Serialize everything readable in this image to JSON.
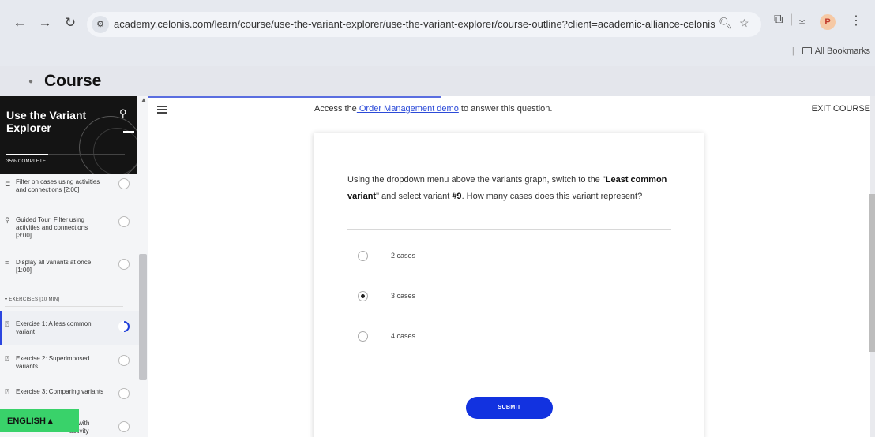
{
  "browser": {
    "url": "academy.celonis.com/learn/course/use-the-variant-explorer/use-the-variant-explorer/course-outline?client=academic-alliance-celonis",
    "bookmarks_label": "All Bookmarks",
    "profile_initial": "P",
    "icons": [
      "back-icon",
      "forward-icon",
      "reload-icon",
      "site-settings-icon",
      "zoom-icon",
      "star-icon",
      "extensions-icon",
      "download-icon",
      "profile-icon",
      "menu-icon"
    ]
  },
  "course_header": {
    "title": "Course"
  },
  "sidebar": {
    "course_title": "Use the Variant Explorer",
    "progress_label": "35% COMPLETE",
    "progress_fraction": 0.35,
    "lessons": [
      {
        "label": "Filter on cases using activities and connections [2:00]",
        "icon": "filter-icon"
      },
      {
        "label": "Guided Tour: Filter using activities and connections [3:00]",
        "icon": "guided-tour-icon"
      },
      {
        "label": "Display all variants at once [1:00]",
        "icon": "list-icon"
      }
    ],
    "section_label": "▾ EXERCISES [10 MIN]",
    "exercises": [
      {
        "label": "Exercise 1: A less common variant",
        "icon": "question-icon"
      },
      {
        "label": "Exercise 2: Superimposed variants",
        "icon": "question-icon"
      },
      {
        "label": "Exercise 3: Comparing variants",
        "icon": "question-icon"
      },
      {
        "label": "ng with activity",
        "icon": "question-icon"
      }
    ],
    "language": "ENGLISH  ▴"
  },
  "main": {
    "access_prefix": "Access the",
    "access_link": " Order Management demo",
    "access_suffix": " to answer this question.",
    "exit_label": "EXIT COURSE",
    "question": {
      "part1": "Using the dropdown menu above the variants graph, switch to the \"",
      "bold1": "Least common variant",
      "part2": "\" and select variant ",
      "bold2": "#9",
      "part3": ". How many cases does this variant represent?"
    },
    "options": [
      {
        "label": "2 cases",
        "selected": false
      },
      {
        "label": "3 cases",
        "selected": true
      },
      {
        "label": "4 cases",
        "selected": false
      }
    ],
    "submit_label": "SUBMIT"
  }
}
